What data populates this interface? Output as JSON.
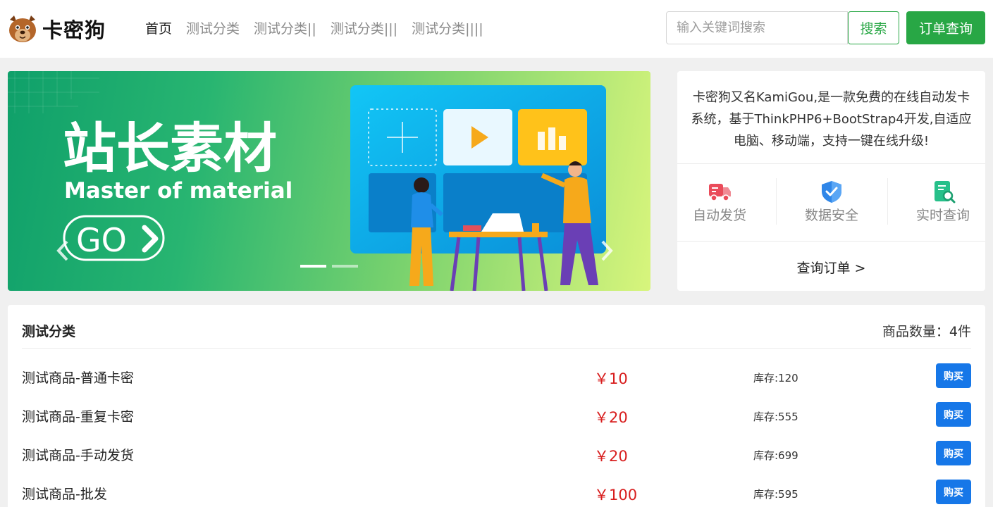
{
  "header": {
    "logo_text": "卡密狗",
    "nav": [
      {
        "label": "首页",
        "active": true
      },
      {
        "label": "测试分类",
        "active": false
      },
      {
        "label": "测试分类||",
        "active": false
      },
      {
        "label": "测试分类|||",
        "active": false
      },
      {
        "label": "测试分类||||",
        "active": false
      }
    ],
    "search_placeholder": "输入关键词搜索",
    "search_label": "搜索",
    "order_query_label": "订单查询"
  },
  "banner": {
    "headline": "站长素材",
    "subline": "Master of material",
    "go_label": "GO",
    "slide_count": 2,
    "active_slide": 1
  },
  "info": {
    "description": "卡密狗又名KamiGou,是一款免费的在线自动发卡系统，基于ThinkPHP6+BootStrap4开发,自适应电脑、移动端，支持一键在线升级!",
    "features": [
      {
        "label": "自动发货",
        "icon": "delivery-truck-icon"
      },
      {
        "label": "数据安全",
        "icon": "shield-check-icon"
      },
      {
        "label": "实时查询",
        "icon": "document-search-icon"
      }
    ],
    "query_order_label": "查询订单 >"
  },
  "category": {
    "title": "测试分类",
    "count_label": "商品数量：",
    "count_value": "4件",
    "buy_label": "购买",
    "products": [
      {
        "name": "测试商品-普通卡密",
        "price": "￥10",
        "stock": "库存:120"
      },
      {
        "name": "测试商品-重复卡密",
        "price": "￥20",
        "stock": "库存:555"
      },
      {
        "name": "测试商品-手动发货",
        "price": "￥20",
        "stock": "库存:699"
      },
      {
        "name": "测试商品-批发",
        "price": "￥100",
        "stock": "库存:595"
      }
    ]
  },
  "colors": {
    "brand_green": "#28a745",
    "price_red": "#d81e1e",
    "buy_blue": "#1677e8"
  }
}
